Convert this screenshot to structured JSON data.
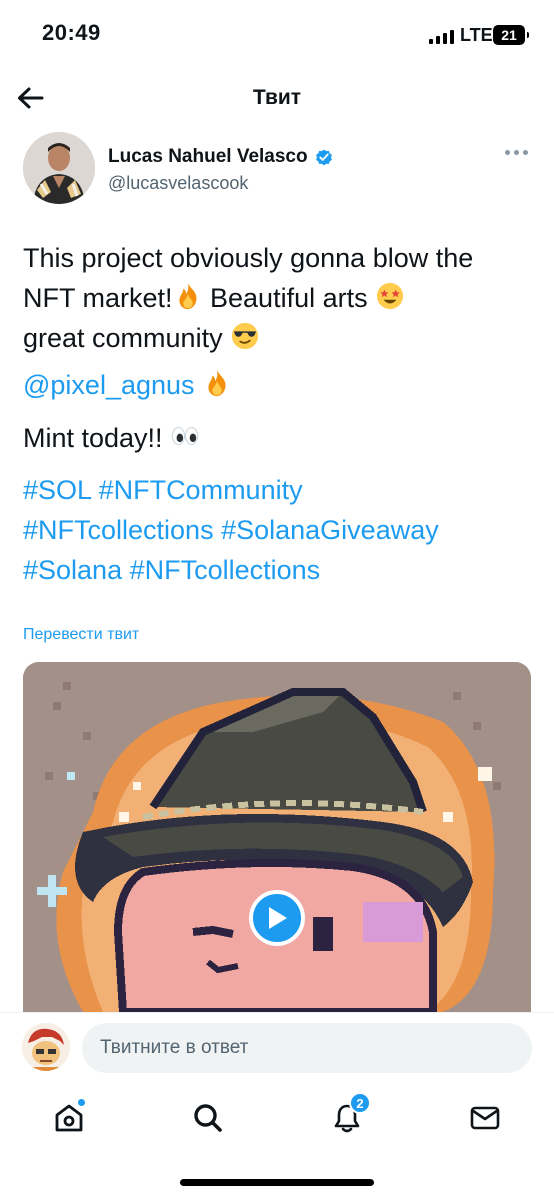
{
  "status_bar": {
    "time": "20:49",
    "network": "LTE",
    "battery": "21"
  },
  "header": {
    "title": "Твит",
    "back_icon": "arrow-left-icon"
  },
  "author": {
    "name": "Lucas Nahuel Velasco",
    "handle": "@lucasvelascook",
    "verified": true
  },
  "tweet": {
    "line1": "This project obviously gonna blow the",
    "line2": "NFT market!",
    "line2b": " Beautiful arts ",
    "line3": "great community ",
    "mention": "@pixel_agnus",
    "mint": "Mint today!! ",
    "hashtags": [
      "#SOL",
      "#NFTCommunity",
      "#NFTcollections",
      "#SolanaGiveaway",
      "#Solana",
      "#NFTcollections"
    ],
    "translate_label": "Перевести твит"
  },
  "reply": {
    "placeholder": "Твитните в ответ"
  },
  "nav": {
    "notifications_count": "2"
  },
  "colors": {
    "accent": "#1d9bf0",
    "text": "#0f1419",
    "secondary": "#536471"
  }
}
